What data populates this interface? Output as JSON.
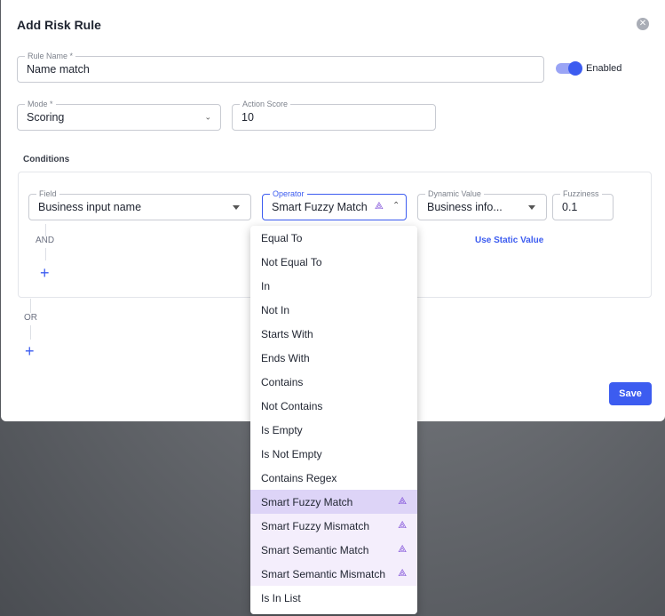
{
  "modal": {
    "title": "Add Risk Rule",
    "close_icon": "close-icon",
    "save_label": "Save"
  },
  "rule_name": {
    "label": "Rule Name *",
    "value": "Name match"
  },
  "enabled": {
    "label": "Enabled",
    "on": true
  },
  "mode": {
    "label": "Mode *",
    "value": "Scoring"
  },
  "action_score": {
    "label": "Action Score",
    "value": "10"
  },
  "conditions": {
    "label": "Conditions",
    "field": {
      "label": "Field",
      "value": "Business input name"
    },
    "operator": {
      "label": "Operator",
      "value": "Smart Fuzzy Match",
      "icon": "sparkle-icon"
    },
    "dynamic_value": {
      "label": "Dynamic Value",
      "value": "Business info..."
    },
    "fuzziness": {
      "label": "Fuzziness",
      "value": "0.1"
    },
    "and_label": "AND",
    "or_label": "OR",
    "use_static_label": "Use Static Value"
  },
  "operator_menu": {
    "items": [
      {
        "label": "Equal To",
        "smart": false
      },
      {
        "label": "Not Equal To",
        "smart": false
      },
      {
        "label": "In",
        "smart": false
      },
      {
        "label": "Not In",
        "smart": false
      },
      {
        "label": "Starts With",
        "smart": false
      },
      {
        "label": "Ends With",
        "smart": false
      },
      {
        "label": "Contains",
        "smart": false
      },
      {
        "label": "Not Contains",
        "smart": false
      },
      {
        "label": "Is Empty",
        "smart": false
      },
      {
        "label": "Is Not Empty",
        "smart": false
      },
      {
        "label": "Contains Regex",
        "smart": false
      },
      {
        "label": "Smart Fuzzy Match",
        "smart": true,
        "selected": true
      },
      {
        "label": "Smart Fuzzy Mismatch",
        "smart": true
      },
      {
        "label": "Smart Semantic Match",
        "smart": true
      },
      {
        "label": "Smart Semantic Mismatch",
        "smart": true
      },
      {
        "label": "Is In List",
        "smart": false
      }
    ]
  },
  "colors": {
    "accent": "#3c5cf0",
    "smart": "#7d4cd8",
    "selected_bg": "#ddd4f7",
    "smart_bg": "#f4eefc"
  }
}
